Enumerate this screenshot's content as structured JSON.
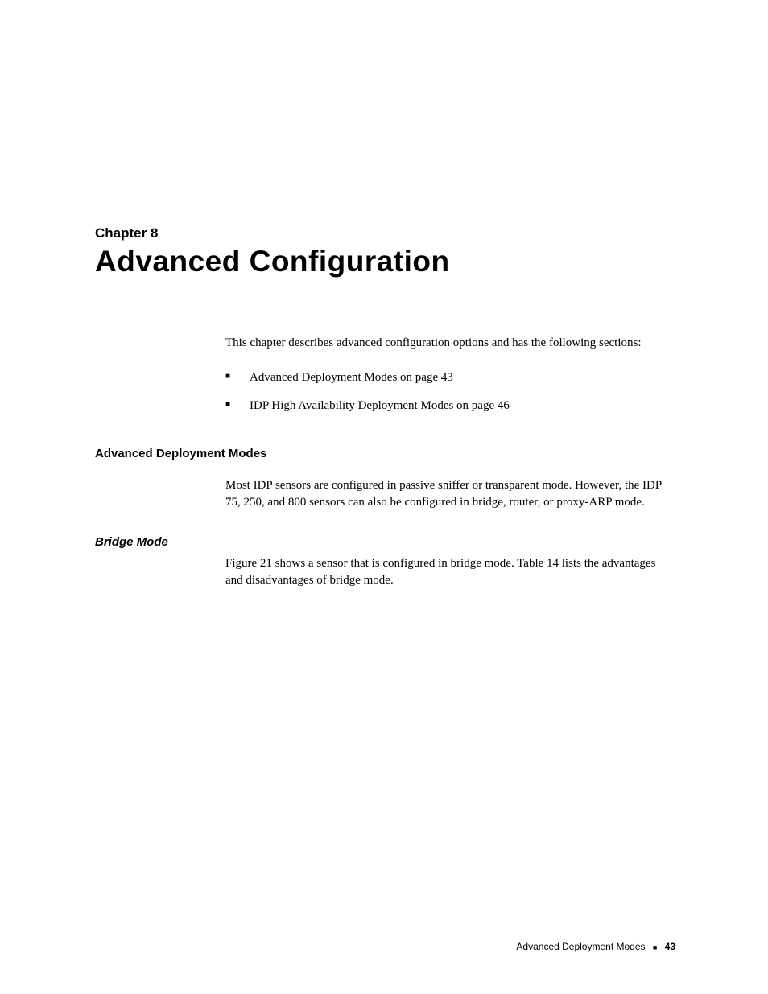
{
  "chapter": {
    "label": "Chapter 8",
    "title": "Advanced Configuration"
  },
  "intro": "This chapter describes advanced configuration options and has the following sections:",
  "toc": [
    "Advanced Deployment Modes on page 43",
    "IDP High Availability Deployment Modes on page 46"
  ],
  "section1": {
    "heading": "Advanced Deployment Modes",
    "body": "Most IDP sensors are configured in passive sniffer or transparent mode. However, the IDP 75, 250, and 800 sensors can also be configured in bridge, router, or proxy-ARP mode."
  },
  "subsection1": {
    "heading": "Bridge Mode",
    "body": "Figure 21 shows a sensor that is configured in bridge mode. Table 14 lists the advantages and disadvantages of bridge mode."
  },
  "footer": {
    "text": "Advanced Deployment Modes",
    "page": "43"
  }
}
